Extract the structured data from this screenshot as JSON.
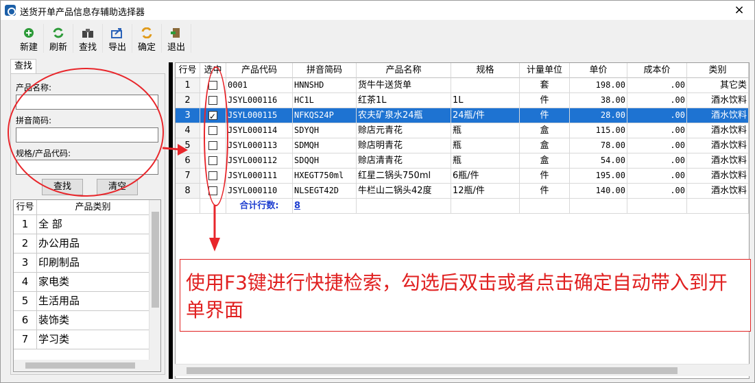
{
  "window": {
    "title": "送货开单产品信息存辅助选择器",
    "close": "×"
  },
  "toolbar": [
    {
      "label": "新建",
      "icon": "add-icon"
    },
    {
      "label": "刷新",
      "icon": "refresh-icon"
    },
    {
      "label": "查找",
      "icon": "binoculars-icon"
    },
    {
      "label": "导出",
      "icon": "export-icon"
    },
    {
      "label": "确定",
      "icon": "confirm-icon"
    },
    {
      "label": "退出",
      "icon": "exit-icon"
    }
  ],
  "search": {
    "tab": "查找",
    "name_label": "产品名称:",
    "pinyin_label": "拼音简码:",
    "spec_label": "规格/产品代码:",
    "search_button": "查找",
    "clear_button": "清空"
  },
  "categories": {
    "headers": [
      "行号",
      "产品类别"
    ],
    "rows": [
      {
        "n": "1",
        "t": "全 部"
      },
      {
        "n": "2",
        "t": "办公用品"
      },
      {
        "n": "3",
        "t": "印刷制品"
      },
      {
        "n": "4",
        "t": "家电类"
      },
      {
        "n": "5",
        "t": "生活用品"
      },
      {
        "n": "6",
        "t": "装饰类"
      },
      {
        "n": "7",
        "t": "学习类"
      }
    ]
  },
  "grid": {
    "headers": [
      "行号",
      "选中",
      "产品代码",
      "拼音简码",
      "产品名称",
      "规格",
      "计量单位",
      "单价",
      "成本价",
      "类别"
    ],
    "rows": [
      {
        "n": "1",
        "checked": false,
        "code": "0001",
        "py": "HNNSHD",
        "name": "货牛牛送货单",
        "spec": "",
        "unit": "套",
        "price": "198.00",
        "cost": ".00",
        "type": "其它类"
      },
      {
        "n": "2",
        "checked": false,
        "code": "JSYL000116",
        "py": "HC1L",
        "name": "红茶1L",
        "spec": "1L",
        "unit": "件",
        "price": "38.00",
        "cost": ".00",
        "type": "酒水饮料"
      },
      {
        "n": "3",
        "checked": true,
        "code": "JSYL000115",
        "py": "NFKQS24P",
        "name": "农夫矿泉水24瓶",
        "spec": "24瓶/件",
        "unit": "件",
        "price": "28.00",
        "cost": ".00",
        "type": "酒水饮料"
      },
      {
        "n": "4",
        "checked": false,
        "code": "JSYL000114",
        "py": "SDYQH",
        "name": "赊店元青花",
        "spec": "瓶",
        "unit": "盒",
        "price": "115.00",
        "cost": ".00",
        "type": "酒水饮料"
      },
      {
        "n": "5",
        "checked": false,
        "code": "JSYL000113",
        "py": "SDMQH",
        "name": "赊店明青花",
        "spec": "瓶",
        "unit": "盒",
        "price": "78.00",
        "cost": ".00",
        "type": "酒水饮料"
      },
      {
        "n": "6",
        "checked": false,
        "code": "JSYL000112",
        "py": "SDQQH",
        "name": "赊店清青花",
        "spec": "瓶",
        "unit": "盒",
        "price": "54.00",
        "cost": ".00",
        "type": "酒水饮料"
      },
      {
        "n": "7",
        "checked": false,
        "code": "JSYL000111",
        "py": "HXEGT750ml",
        "name": "红星二锅头750ml",
        "spec": "6瓶/件",
        "unit": "件",
        "price": "195.00",
        "cost": ".00",
        "type": "酒水饮料"
      },
      {
        "n": "8",
        "checked": false,
        "code": "JSYL000110",
        "py": "NLSEGT42D",
        "name": "牛栏山二锅头42度",
        "spec": "12瓶/件",
        "unit": "件",
        "price": "140.00",
        "cost": ".00",
        "type": "酒水饮料"
      }
    ],
    "total_label": "合计行数:",
    "total_value": "8"
  },
  "annotation": {
    "text": "使用F3键进行快捷检索，勾选后双击或者点击确定自动带入到开单界面",
    "color": "#e02020"
  }
}
